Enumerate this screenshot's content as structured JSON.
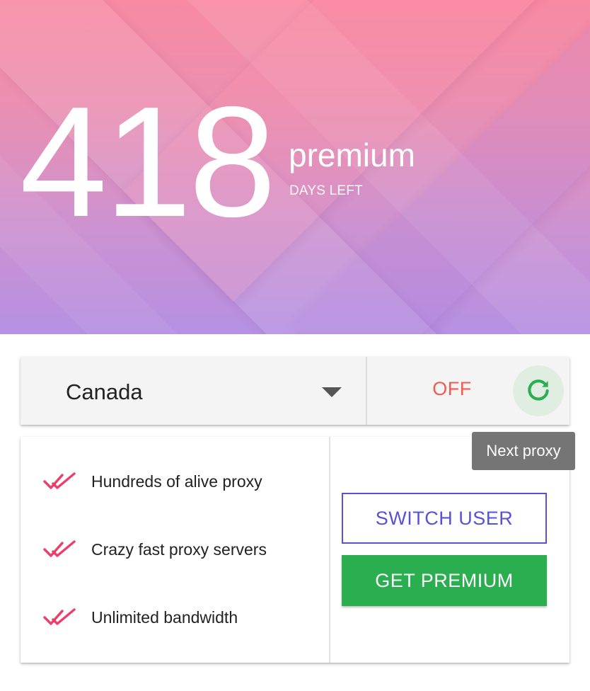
{
  "hero": {
    "days_number": "418",
    "plan_name": "premium",
    "days_caption": "DAYS LEFT"
  },
  "control_bar": {
    "country": "Canada",
    "status": "OFF",
    "next_proxy_icon": "refresh-icon"
  },
  "tooltip": {
    "text": "Next proxy"
  },
  "features": {
    "items": [
      {
        "label": "Hundreds of alive proxy",
        "icon": "double-check-icon"
      },
      {
        "label": "Crazy fast proxy servers",
        "icon": "double-check-icon"
      },
      {
        "label": "Unlimited bandwidth",
        "icon": "double-check-icon"
      }
    ]
  },
  "actions": {
    "switch_user_label": "SWITCH USER",
    "get_premium_label": "GET PREMIUM"
  },
  "colors": {
    "status_off": "#f25a4f",
    "accent_blue": "#5753d6",
    "premium_green": "#2aae50",
    "refresh_green": "#2aae50",
    "check_pink": "#ec3d6c"
  }
}
